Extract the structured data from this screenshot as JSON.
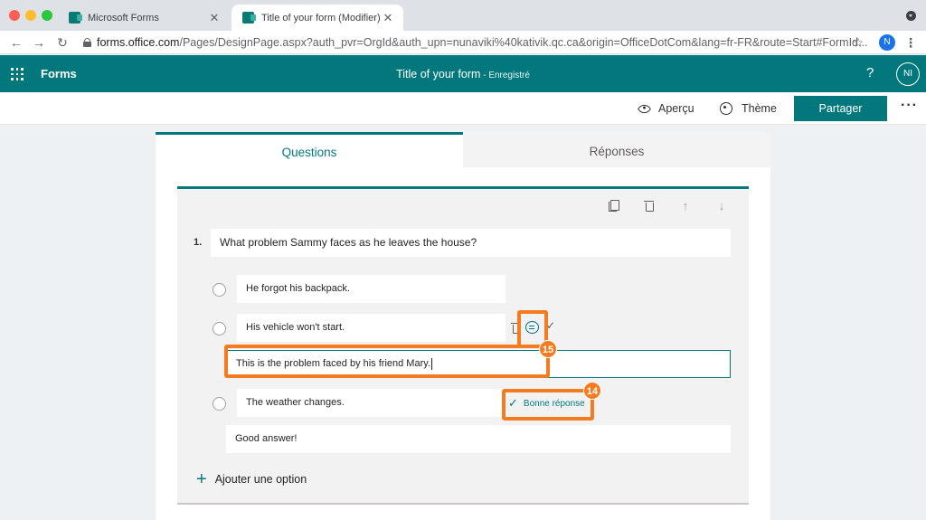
{
  "browser": {
    "tabs": [
      {
        "title": "Microsoft Forms",
        "close": "✕"
      },
      {
        "title": "Title of your form (Modifier) M",
        "close": "✕"
      }
    ],
    "nav": {
      "back": "←",
      "forward": "→",
      "reload": "↻"
    },
    "url_host": "forms.office.com",
    "url_rest": "/Pages/DesignPage.aspx?auth_pvr=OrgId&auth_upn=nunaviki%40kativik.qc.ca&origin=OfficeDotCom&lang=fr-FR&route=Start#FormId...",
    "star": "☆",
    "user_initial": "N",
    "menu": "⋮"
  },
  "app": {
    "name": "Forms",
    "doc_title": "Title of your form",
    "separator": " - ",
    "save_status": "Enregistré",
    "help": "?",
    "user_initials": "NI"
  },
  "toolbar": {
    "preview_label": "Aperçu",
    "theme_label": "Thème",
    "share_label": "Partager",
    "more": "···"
  },
  "tabs": {
    "questions": "Questions",
    "responses": "Réponses"
  },
  "question": {
    "number": "1.",
    "title": "What problem Sammy faces as he leaves the house?",
    "tools": {
      "up": "↑",
      "down": "↓"
    },
    "options": [
      {
        "text": "He forgot his backpack."
      },
      {
        "text": "His vehicle won't start.",
        "feedback": "This is the problem faced by his friend Mary."
      },
      {
        "text": "The weather changes.",
        "correct_label": "Bonne réponse",
        "feedback": "Good answer!"
      }
    ],
    "add_option": "Ajouter une option",
    "check_mark": "✓",
    "plus": "+"
  },
  "annotations": {
    "badge_14": "14",
    "badge_15": "15",
    "accent": "#f47b20"
  },
  "colors": {
    "brand": "#03787c",
    "chrome": "#dee1e6"
  }
}
